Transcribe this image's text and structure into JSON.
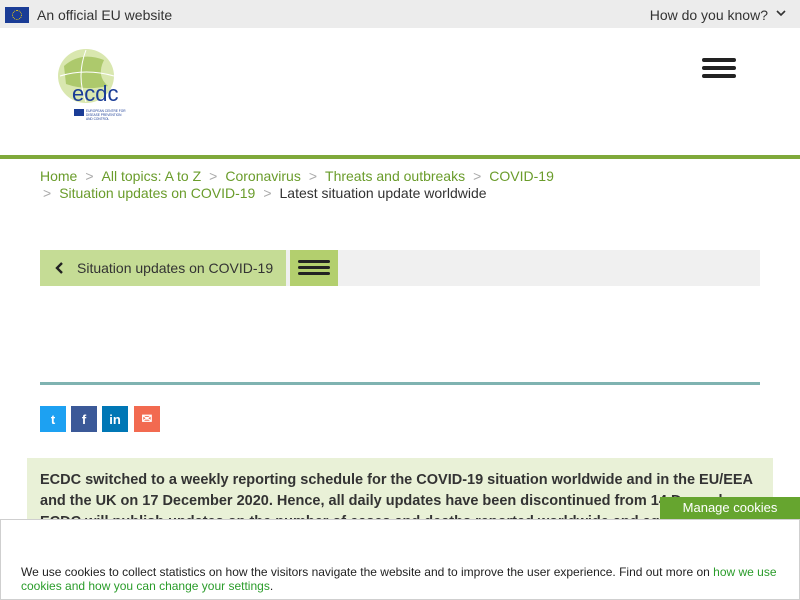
{
  "eu_banner": {
    "official_text": "An official EU website",
    "how_know": "How do you know?"
  },
  "logo": {
    "brand_text": "ecdc",
    "subtitle": "EUROPEAN CENTRE FOR DISEASE PREVENTION AND CONTROL"
  },
  "breadcrumb": {
    "items": [
      "Home",
      "All topics: A to Z",
      "Coronavirus",
      "Threats and outbreaks",
      "COVID-19",
      "Situation updates on COVID-19"
    ],
    "current": "Latest situation update worldwide",
    "separator": ">"
  },
  "subnav": {
    "back_label": "Situation updates on COVID-19"
  },
  "share": {
    "twitter": "t",
    "facebook": "f",
    "linkedin": "in",
    "email": "✉"
  },
  "notice": {
    "text": "ECDC switched to a weekly reporting schedule for the COVID-19 situation worldwide and in the EU/EEA and the UK on 17 December 2020. Hence, all daily updates have been discontinued from 14 December. ECDC will publish updates on the number of cases and deaths reported worldwide and aggregated by week every Thursday."
  },
  "cookies": {
    "manage_label": "Manage cookies",
    "message": "We use cookies to collect statistics on how the visitors navigate the website and to improve the user experience. Find out more on ",
    "link_text": "how we use cookies and how you can change your settings",
    "end": "."
  },
  "colors": {
    "green": "#7fa93a",
    "link": "#6a9c2b",
    "teal": "#7fb3b1",
    "notice_bg": "#e9f1d7"
  }
}
